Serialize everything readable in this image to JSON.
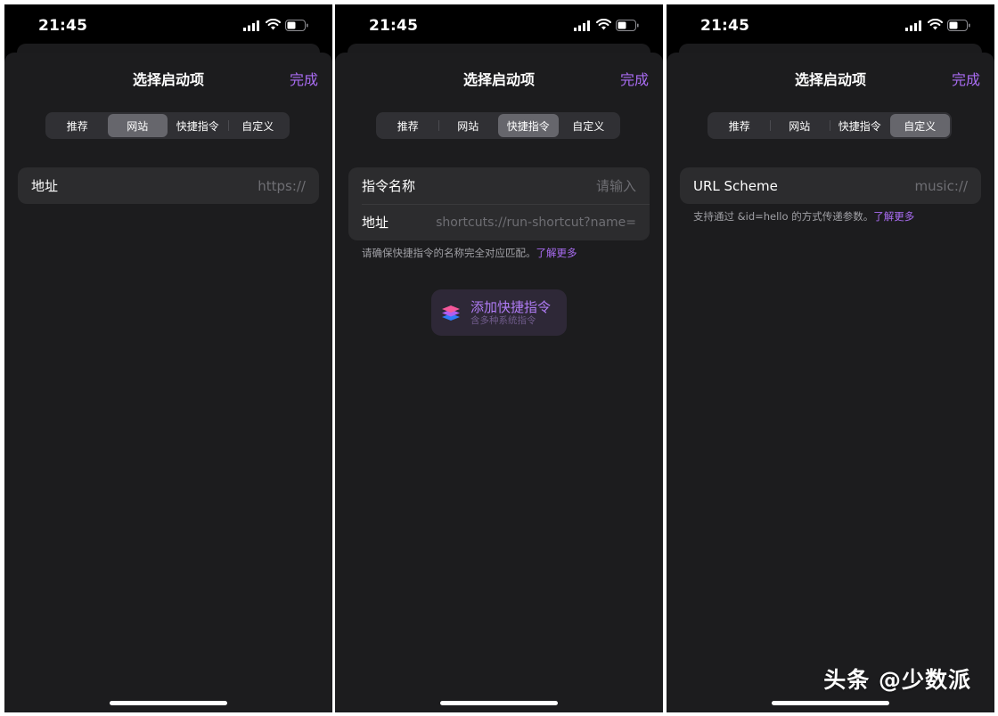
{
  "status_time": "21:45",
  "title": "选择启动项",
  "done_label": "完成",
  "tabs": [
    "推荐",
    "网站",
    "快捷指令",
    "自定义"
  ],
  "screens": [
    {
      "active_tab": "网站",
      "rows": [
        {
          "label": "地址",
          "placeholder": "https://"
        }
      ]
    },
    {
      "active_tab": "快捷指令",
      "rows": [
        {
          "label": "指令名称",
          "placeholder": "请输入"
        },
        {
          "label": "地址",
          "value": "shortcuts://run-shortcut?name="
        }
      ],
      "note": "请确保快捷指令的名称完全对应匹配。",
      "note_link": "了解更多",
      "add_button": {
        "title": "添加快捷指令",
        "subtitle": "含多种系统指令",
        "icon": "shortcuts-app-icon"
      }
    },
    {
      "active_tab": "自定义",
      "rows": [
        {
          "label": "URL Scheme",
          "placeholder": "music://"
        }
      ],
      "note": "支持通过 &id=hello 的方式传递参数。",
      "note_link": "了解更多"
    }
  ],
  "watermark": "头条 @少数派",
  "colors": {
    "accent": "#a96cf2",
    "sheet_bg": "#1c1c1e",
    "cell_bg": "#2c2c2e",
    "segment_bg": "#303034",
    "segment_active": "#66666c"
  }
}
